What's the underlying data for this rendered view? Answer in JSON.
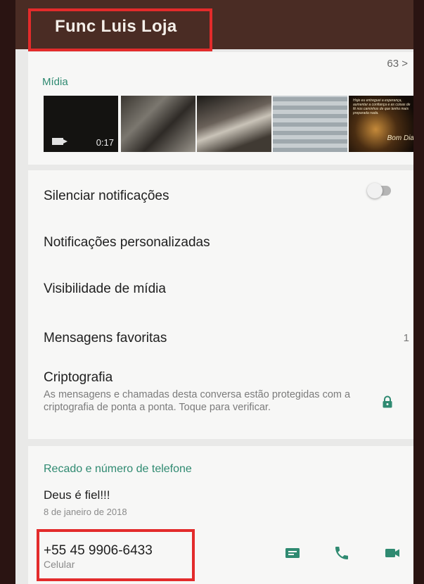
{
  "header": {
    "contact_name": "Func Luis Loja"
  },
  "media": {
    "label": "Mídia",
    "count": "63 >",
    "video_duration": "0:17",
    "thumb5_text": "Hoje eu entreguei a esperança, aumentar a confiança e as coisas de fé nos caminhos de que tenho mais preparada nada.",
    "thumb5_caption": "Bom Dia"
  },
  "settings": {
    "silence_label": "Silenciar notificações",
    "custom_label": "Notificações personalizadas",
    "visibility_label": "Visibilidade de mídia",
    "favorites_label": "Mensagens favoritas",
    "favorites_count": "1",
    "crypto_title": "Criptografia",
    "crypto_description": "As mensagens e chamadas desta conversa estão protegidas com a criptografia de ponta a ponta. Toque para verificar.",
    "silence_enabled": false
  },
  "about": {
    "label": "Recado e número de telefone",
    "status": "Deus é fiel!!!",
    "date": "8 de janeiro de 2018",
    "phone": "+55 45 9906-6433",
    "phone_type": "Celular"
  },
  "colors": {
    "accent": "#2f8a71",
    "header": "#4a2c24",
    "highlight": "#e32b2b"
  },
  "icons": [
    "video-icon",
    "lock-icon",
    "message-icon",
    "call-icon",
    "video-call-icon"
  ]
}
